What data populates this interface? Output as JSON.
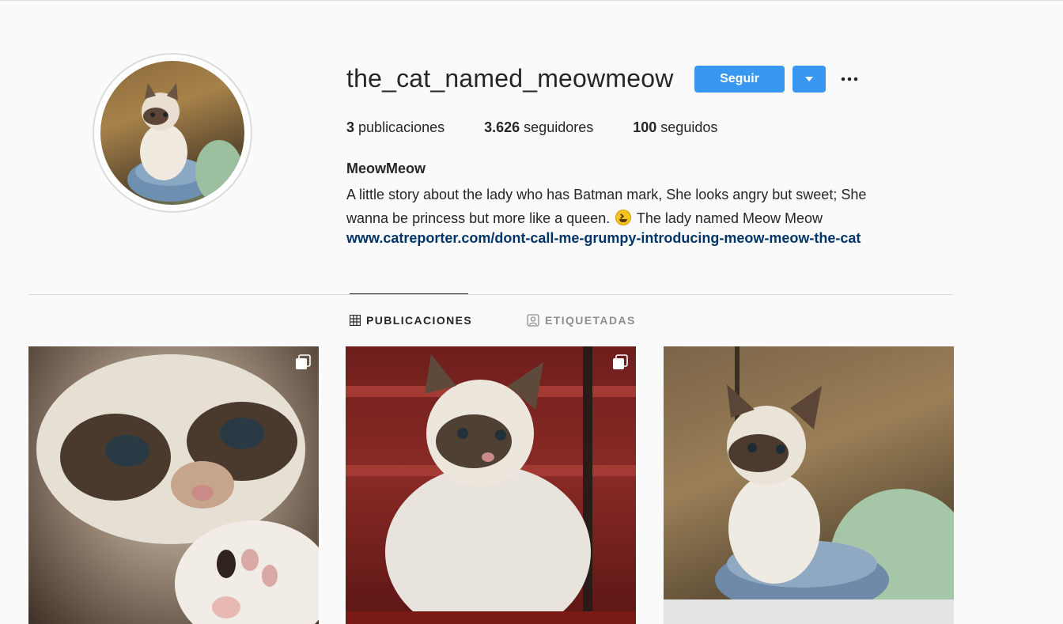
{
  "profile": {
    "username": "the_cat_named_meowmeow",
    "follow_label": "Seguir",
    "stats": [
      {
        "count": "3",
        "label": "publicaciones"
      },
      {
        "count": "3.626",
        "label": "seguidores"
      },
      {
        "count": "100",
        "label": "seguidos"
      }
    ],
    "full_name": "MeowMeow",
    "bio_line1": "A little story about the lady who has Batman mark, She looks angry but sweet; She",
    "bio_line2a": "wanna be princess but more like a queen.",
    "bio_line2b": " The lady named Meow Meow",
    "link": "www.catreporter.com/dont-call-me-grumpy-introducing-meow-meow-the-cat"
  },
  "tabs": [
    {
      "label": "PUBLICACIONES",
      "icon": "grid-icon",
      "active": true
    },
    {
      "label": "ETIQUETADAS",
      "icon": "tagged-icon",
      "active": false
    }
  ],
  "posts": [
    {
      "name": "grumpy cat close-up with paw",
      "multi": true
    },
    {
      "name": "cat sitting on red stairs",
      "multi": true
    },
    {
      "name": "cat sitting in litter box",
      "multi": false
    }
  ],
  "colors": {
    "accent": "#3897f0",
    "link": "#003569",
    "background": "#fafafa",
    "muted": "#8e8e8e"
  }
}
